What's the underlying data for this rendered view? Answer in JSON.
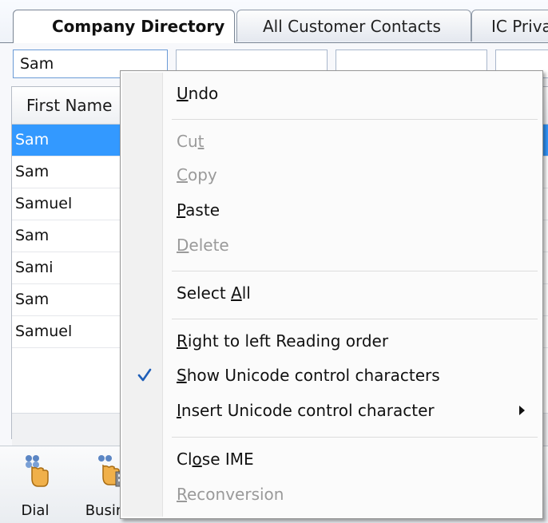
{
  "tabs": {
    "company_directory": "Company Directory",
    "all_customer_contacts": "All Customer Contacts",
    "ic_private": "IC Priva"
  },
  "search": {
    "first_name_value": "Sam"
  },
  "grid": {
    "first_name_header": "First Name",
    "rows": [
      {
        "first_name": "Sam",
        "selected": true
      },
      {
        "first_name": "Sam",
        "selected": false
      },
      {
        "first_name": "Samuel",
        "selected": false
      },
      {
        "first_name": "Sam",
        "selected": false
      },
      {
        "first_name": "Sami",
        "selected": false
      },
      {
        "first_name": "Sam",
        "selected": false
      },
      {
        "first_name": "Samuel",
        "selected": false
      }
    ]
  },
  "toolbar": {
    "dial_label": "Dial",
    "business_label": "Busine",
    "dial_icon": "phone-hand-icon",
    "business_icon": "building-phone-icon"
  },
  "context_menu": {
    "undo": {
      "pre": "",
      "u": "U",
      "post": "ndo"
    },
    "cut": {
      "pre": "Cu",
      "u": "t",
      "post": ""
    },
    "copy": {
      "pre": "",
      "u": "C",
      "post": "opy"
    },
    "paste": {
      "pre": "",
      "u": "P",
      "post": "aste"
    },
    "delete": {
      "pre": "",
      "u": "D",
      "post": "elete"
    },
    "select_all": {
      "pre": "Select ",
      "u": "A",
      "post": "ll"
    },
    "rtl": {
      "pre": "",
      "u": "R",
      "post": "ight to left Reading order"
    },
    "show_unicode": {
      "pre": "",
      "u": "S",
      "post": "how Unicode control characters"
    },
    "insert_unicode": {
      "pre": "",
      "u": "I",
      "post": "nsert Unicode control character"
    },
    "close_ime": {
      "pre": "Cl",
      "u": "o",
      "post": "se IME"
    },
    "reconversion": {
      "pre": "",
      "u": "R",
      "post": "econversion"
    },
    "check_icon": "checkmark-icon",
    "submenu_icon": "submenu-arrow-icon",
    "check_color": "#1f5fb8",
    "selection_color": "#3399ff"
  }
}
